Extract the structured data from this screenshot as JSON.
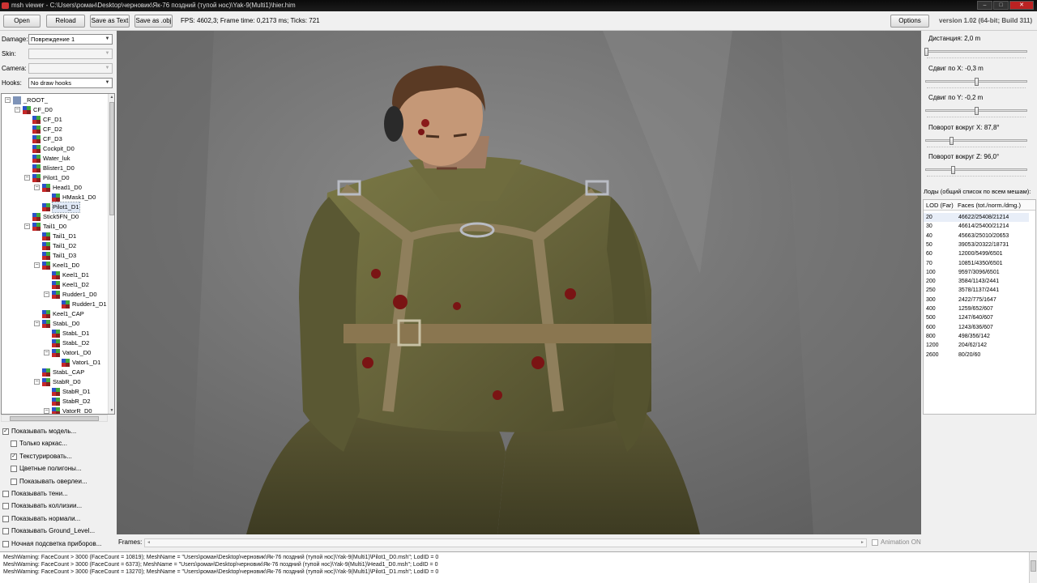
{
  "window": {
    "title": "msh viewer - C:\\Users\\роман\\Desktop\\черновик\\Як-76 поздний (тупой нос)\\Yak-9(Multi1)\\hier.him"
  },
  "toolbar": {
    "open_label": "Open",
    "reload_label": "Reload",
    "save_text_label": "Save as Text",
    "save_obj_label": "Save as .obj",
    "fps_text": "FPS: 4602,3; Frame time: 0,2173 ms; Ticks: 721",
    "options_label": "Options",
    "version": "version 1.02 (64-bit; Build 311)"
  },
  "fields": {
    "damage_label": "Damage:",
    "damage_value": "Повреждение 1",
    "skin_label": "Skin:",
    "skin_value": "",
    "camera_label": "Camera:",
    "camera_value": "",
    "hooks_label": "Hooks:",
    "hooks_value": "No draw hooks"
  },
  "tree": [
    {
      "label": "_ROOT_",
      "depth": 0,
      "expanded": true,
      "root": true
    },
    {
      "label": "CF_D0",
      "depth": 1,
      "expanded": true
    },
    {
      "label": "CF_D1",
      "depth": 2
    },
    {
      "label": "CF_D2",
      "depth": 2
    },
    {
      "label": "CF_D3",
      "depth": 2
    },
    {
      "label": "Cockpit_D0",
      "depth": 2
    },
    {
      "label": "Water_luk",
      "depth": 2
    },
    {
      "label": "Blister1_D0",
      "depth": 2
    },
    {
      "label": "Pilot1_D0",
      "depth": 2,
      "expanded": true
    },
    {
      "label": "Head1_D0",
      "depth": 3,
      "expanded": true
    },
    {
      "label": "HMask1_D0",
      "depth": 4
    },
    {
      "label": "Pilot1_D1",
      "depth": 3,
      "selected": true
    },
    {
      "label": "Stick5FN_D0",
      "depth": 2
    },
    {
      "label": "Tail1_D0",
      "depth": 2,
      "expanded": true
    },
    {
      "label": "Tail1_D1",
      "depth": 3
    },
    {
      "label": "Tail1_D2",
      "depth": 3
    },
    {
      "label": "Tail1_D3",
      "depth": 3
    },
    {
      "label": "Keel1_D0",
      "depth": 3,
      "expanded": true
    },
    {
      "label": "Keel1_D1",
      "depth": 4
    },
    {
      "label": "Keel1_D2",
      "depth": 4
    },
    {
      "label": "Rudder1_D0",
      "depth": 4,
      "expanded": true
    },
    {
      "label": "Rudder1_D1",
      "depth": 5
    },
    {
      "label": "Keel1_CAP",
      "depth": 3
    },
    {
      "label": "StabL_D0",
      "depth": 3,
      "expanded": true
    },
    {
      "label": "StabL_D1",
      "depth": 4
    },
    {
      "label": "StabL_D2",
      "depth": 4
    },
    {
      "label": "VatorL_D0",
      "depth": 4,
      "expanded": true
    },
    {
      "label": "VatorL_D1",
      "depth": 5
    },
    {
      "label": "StabL_CAP",
      "depth": 3
    },
    {
      "label": "StabR_D0",
      "depth": 3,
      "expanded": true
    },
    {
      "label": "StabR_D1",
      "depth": 4
    },
    {
      "label": "StabR_D2",
      "depth": 4
    },
    {
      "label": "VatorR_D0",
      "depth": 4,
      "expanded": true
    }
  ],
  "checkboxes": [
    {
      "label": "Показывать модель...",
      "checked": true,
      "indent": false
    },
    {
      "label": "Только каркас...",
      "checked": false,
      "indent": true
    },
    {
      "label": "Текстурировать...",
      "checked": true,
      "indent": true
    },
    {
      "label": "Цветные полигоны...",
      "checked": false,
      "indent": true
    },
    {
      "label": "Показывать оверлеи...",
      "checked": false,
      "indent": true
    },
    {
      "label": "Показывать тени...",
      "checked": false,
      "indent": false
    },
    {
      "label": "Показывать коллизии...",
      "checked": false,
      "indent": false
    },
    {
      "label": "Показывать нормали...",
      "checked": false,
      "indent": false
    },
    {
      "label": "Показывать Ground_Level...",
      "checked": false,
      "indent": false
    },
    {
      "label": "Ночная подсветка приборов...",
      "checked": false,
      "indent": false
    }
  ],
  "frames": {
    "label": "Frames:",
    "animation_label": "Animation ON",
    "animation_on": false
  },
  "sliders": [
    {
      "label": "Дистанция:",
      "value": "2,0 m",
      "level": 0.0
    },
    {
      "label": "Сдвиг по X:",
      "value": "-0,3 m",
      "level": 0.5
    },
    {
      "label": "Сдвиг по Y:",
      "value": "-0,2 m",
      "level": 0.5
    },
    {
      "label": "Поворот вокруг X:",
      "value": "87,8°",
      "level": 0.25
    },
    {
      "label": "Поворот вокруг Z:",
      "value": "96,0°",
      "level": 0.27
    }
  ],
  "lods": {
    "title": "Лоды (общий список по всем мешам):",
    "col_lod": "LOD (Far)",
    "col_faces": "Faces (tot./norm./dmg.)",
    "rows": [
      [
        "20",
        "46622/25408/21214"
      ],
      [
        "30",
        "46614/25400/21214"
      ],
      [
        "40",
        "45663/25010/20653"
      ],
      [
        "50",
        "39053/20322/18731"
      ],
      [
        "60",
        "12000/5499/6501"
      ],
      [
        "70",
        "10851/4350/6501"
      ],
      [
        "100",
        "9597/3096/6501"
      ],
      [
        "200",
        "3584/1143/2441"
      ],
      [
        "250",
        "3578/1137/2441"
      ],
      [
        "300",
        "2422/775/1647"
      ],
      [
        "400",
        "1259/652/607"
      ],
      [
        "500",
        "1247/640/607"
      ],
      [
        "600",
        "1243/636/607"
      ],
      [
        "800",
        "498/356/142"
      ],
      [
        "1200",
        "204/62/142"
      ],
      [
        "2600",
        "80/20/60"
      ]
    ]
  },
  "log": [
    "MeshWarning: FaceCount > 3000 (FaceCount = 10819); MeshName = \"Users\\роман\\Desktop\\черновик\\Як-76 поздний (тупой нос)\\Yak-9(Multi1)\\Pilot1_D0.msh\"; LodID = 0",
    "MeshWarning: FaceCount > 3000 (FaceCount = 6373); MeshName = \"Users\\роман\\Desktop\\черновик\\Як-76 поздний (тупой нос)\\Yak-9(Multi1)\\Head1_D0.msh\"; LodID = 0",
    "MeshWarning: FaceCount > 3000 (FaceCount = 13270); MeshName = \"Users\\роман\\Desktop\\черновик\\Як-76 поздний (тупой нос)\\Yak-9(Multi1)\\Pilot1_D1.msh\"; LodID = 0"
  ],
  "colors": {
    "uniform": "#6b6a3a",
    "belt": "#8f7f5c",
    "viewport_bg": "#6d6d6d",
    "blood": "#7a1414"
  }
}
